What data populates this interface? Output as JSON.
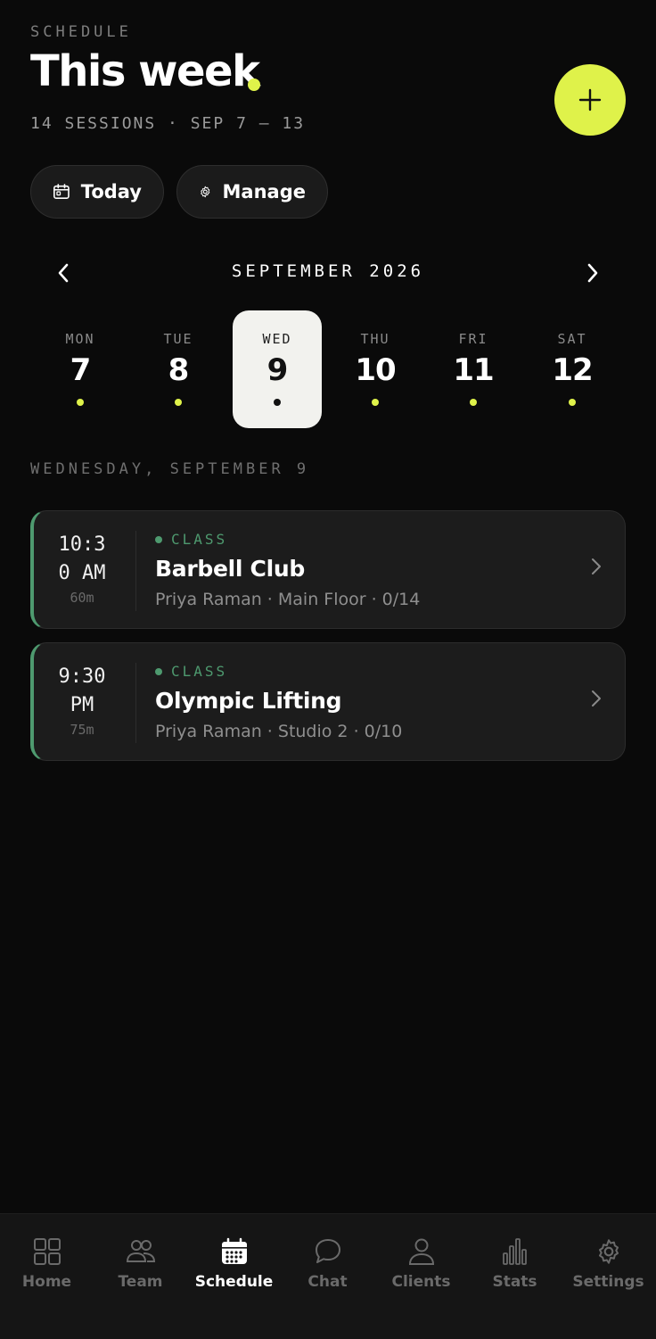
{
  "header": {
    "eyebrow": "SCHEDULE",
    "title": "This week",
    "subtitle": "14 SESSIONS · SEP 7 – 13",
    "accent_color": "#dff24a",
    "add_icon": "plus-icon"
  },
  "actions": {
    "today_label": "Today",
    "today_icon": "calendar-icon",
    "manage_label": "Manage",
    "manage_icon": "gear-icon"
  },
  "calendar": {
    "month_label": "SEPTEMBER 2026",
    "prev_icon": "chevron-left-icon",
    "next_icon": "chevron-right-icon",
    "days": [
      {
        "name": "MON",
        "num": "7",
        "has_sessions": true,
        "selected": false
      },
      {
        "name": "TUE",
        "num": "8",
        "has_sessions": true,
        "selected": false
      },
      {
        "name": "WED",
        "num": "9",
        "has_sessions": true,
        "selected": true
      },
      {
        "name": "THU",
        "num": "10",
        "has_sessions": true,
        "selected": false
      },
      {
        "name": "FRI",
        "num": "11",
        "has_sessions": true,
        "selected": false
      },
      {
        "name": "SAT",
        "num": "12",
        "has_sessions": true,
        "selected": false
      }
    ]
  },
  "day_heading": "WEDNESDAY, SEPTEMBER 9",
  "sessions": [
    {
      "time_line1": "10:3",
      "time_line2": "0 AM",
      "duration": "60m",
      "type": "CLASS",
      "name": "Barbell Club",
      "meta": "Priya Raman · Main Floor · 0/14",
      "type_color": "#4e9a6f"
    },
    {
      "time_line1": "9:30",
      "time_line2": "PM",
      "duration": "75m",
      "type": "CLASS",
      "name": "Olympic Lifting",
      "meta": "Priya Raman · Studio 2 · 0/10",
      "type_color": "#4e9a6f"
    }
  ],
  "tabs": [
    {
      "label": "Home",
      "icon": "grid-icon",
      "active": false
    },
    {
      "label": "Team",
      "icon": "team-icon",
      "active": false
    },
    {
      "label": "Schedule",
      "icon": "calendar-icon",
      "active": true
    },
    {
      "label": "Chat",
      "icon": "chat-bubble-icon",
      "active": false
    },
    {
      "label": "Clients",
      "icon": "person-icon",
      "active": false
    },
    {
      "label": "Stats",
      "icon": "bar-chart-icon",
      "active": false
    },
    {
      "label": "Settings",
      "icon": "gear-icon",
      "active": false
    }
  ]
}
